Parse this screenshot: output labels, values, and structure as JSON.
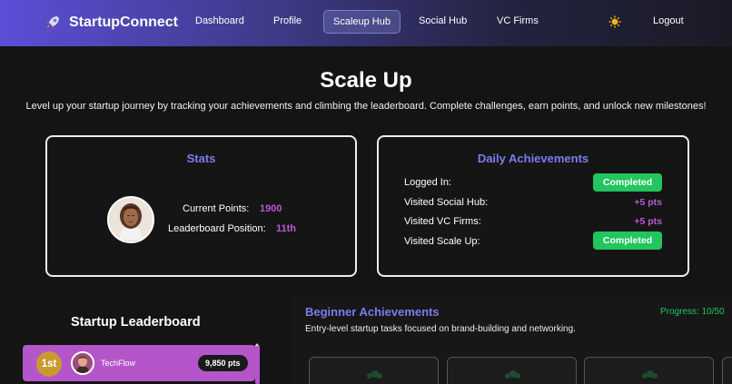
{
  "navbar": {
    "brand": "StartupConnect",
    "links": [
      "Dashboard",
      "Profile",
      "Scaleup Hub",
      "Social Hub",
      "VC Firms"
    ],
    "active_link": "Scaleup Hub",
    "logout": "Logout",
    "theme_icon": "sun-icon",
    "brand_icon": "rocket-icon"
  },
  "header": {
    "title": "Scale Up",
    "subtitle": "Level up your startup journey by tracking your achievements and climbing the leaderboard. Complete challenges, earn points, and unlock new milestones!"
  },
  "stats": {
    "title": "Stats",
    "current_points_label": "Current Points:",
    "current_points": "1900",
    "position_label": "Leaderboard Position:",
    "position": "11th"
  },
  "daily": {
    "title": "Daily Achievements",
    "items": [
      {
        "label": "Logged In:",
        "status": "Completed"
      },
      {
        "label": "Visited Social Hub:",
        "status": "+5 pts"
      },
      {
        "label": "Visited VC Firms:",
        "status": "+5 pts"
      },
      {
        "label": "Visited Scale Up:",
        "status": "Completed"
      }
    ]
  },
  "leaderboard": {
    "title": "Startup Leaderboard",
    "entries": [
      {
        "rank": "1st",
        "name": "TechFlow",
        "points": "9,850 pts"
      }
    ]
  },
  "beginner": {
    "title": "Beginner Achievements",
    "description": "Entry-level startup tasks focused on brand-building and networking.",
    "progress": "Progress: 10/50"
  },
  "colors": {
    "accent": "#7b7cf0",
    "purple_value": "#b95ad1",
    "success": "#22c55e",
    "gold": "#c99a2e"
  }
}
